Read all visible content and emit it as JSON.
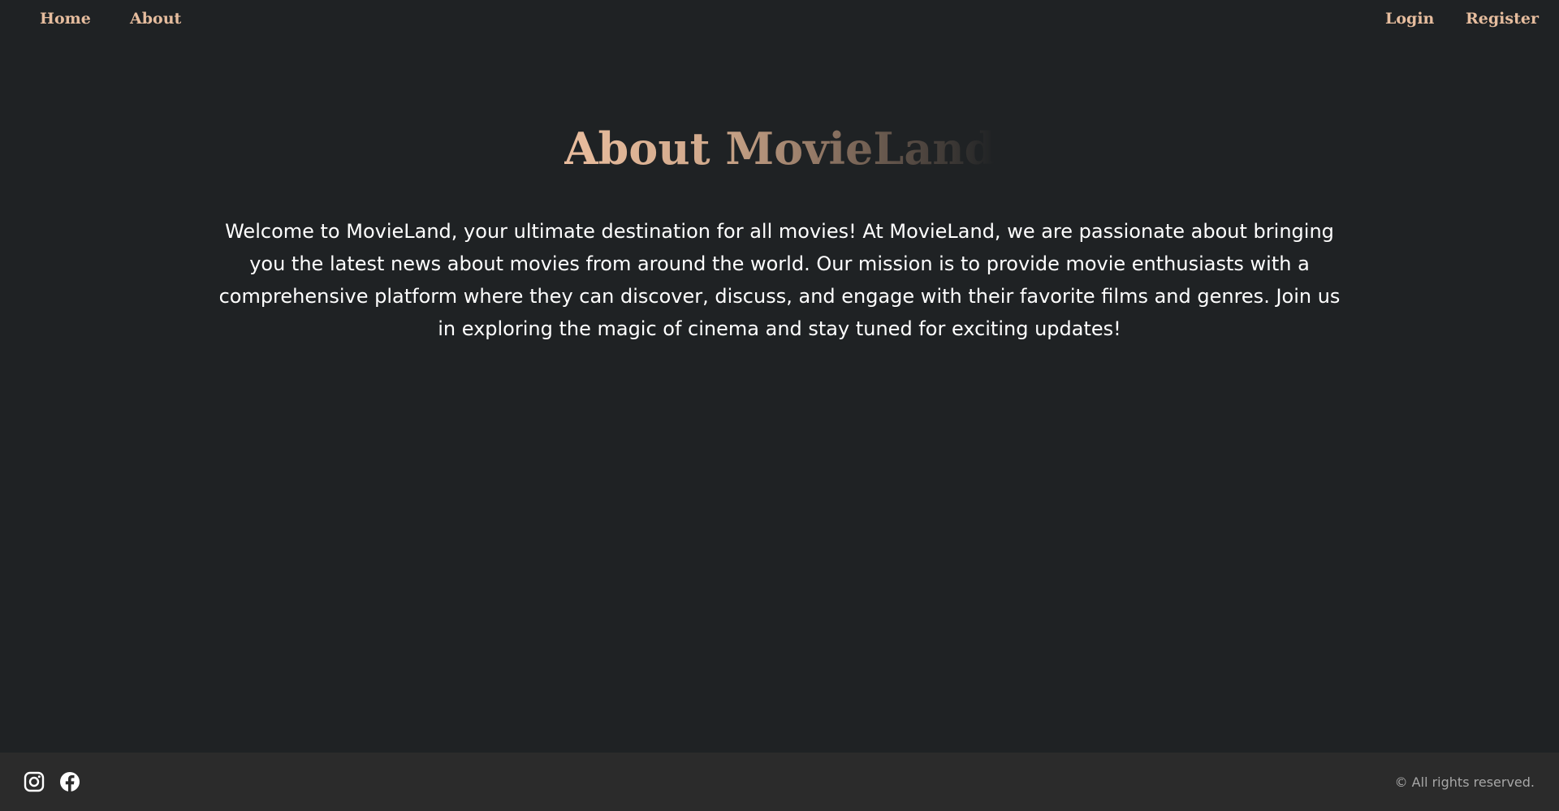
{
  "nav": {
    "home": "Home",
    "about": "About",
    "login": "Login",
    "register": "Register"
  },
  "main": {
    "title": "About MovieLand",
    "description": "Welcome to MovieLand, your ultimate destination for all movies! At MovieLand, we are passionate about bringing you the latest news about movies from around the world. Our mission is to provide movie enthusiasts with a comprehensive platform where they can discover, discuss, and engage with their favorite films and genres. Join us in exploring the magic of cinema and stay tuned for exciting updates!"
  },
  "footer": {
    "social_icons": [
      "instagram-icon",
      "facebook-icon"
    ],
    "copyright": "© All rights reserved."
  },
  "colors": {
    "background": "#1f2224",
    "accent": "#e6bd9e",
    "footer_background": "#2b2b2b",
    "text": "#ffffff",
    "muted_text": "#a7a7a7"
  }
}
